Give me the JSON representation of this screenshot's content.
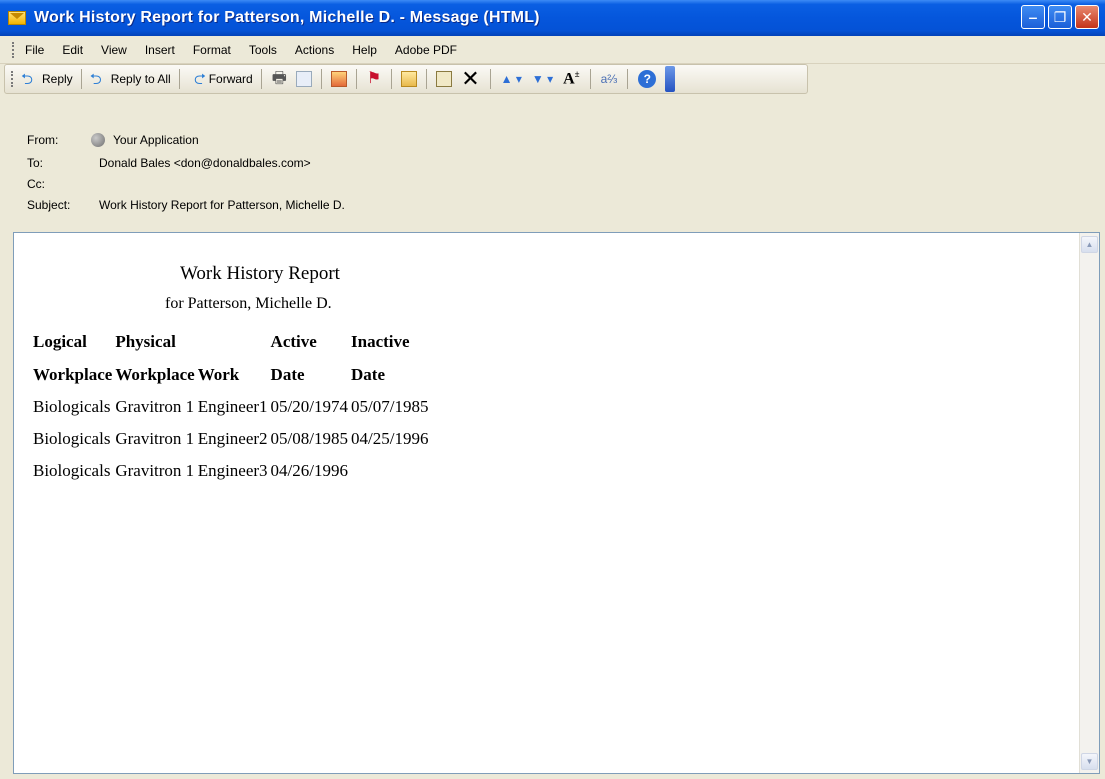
{
  "window": {
    "title": "Work History Report for Patterson, Michelle D. - Message (HTML)"
  },
  "menu": {
    "items": [
      "File",
      "Edit",
      "View",
      "Insert",
      "Format",
      "Tools",
      "Actions",
      "Help",
      "Adobe PDF"
    ]
  },
  "toolbar": {
    "reply_label": "Reply",
    "reply_all_label": "Reply to All",
    "forward_label": "Forward"
  },
  "header": {
    "from_label": "From:",
    "from_value": "Your Application",
    "to_label": "To:",
    "to_value": "Donald Bales <don@donaldbales.com>",
    "cc_label": "Cc:",
    "cc_value": "",
    "subject_label": "Subject:",
    "subject_value": "Work History Report for Patterson, Michelle D."
  },
  "report": {
    "title": "Work History Report",
    "subtitle": "for Patterson, Michelle D.",
    "header_row1": [
      "Logical",
      "Physical",
      "",
      "Active",
      "Inactive"
    ],
    "header_row2": [
      "Workplace",
      "Workplace",
      "Work",
      "Date",
      "Date"
    ],
    "rows": [
      [
        "Biologicals",
        "Gravitron 1",
        "Engineer1",
        "05/20/1974",
        "05/07/1985"
      ],
      [
        "Biologicals",
        "Gravitron 1",
        "Engineer2",
        "05/08/1985",
        "04/25/1996"
      ],
      [
        "Biologicals",
        "Gravitron 1",
        "Engineer3",
        "04/26/1996",
        ""
      ]
    ]
  }
}
